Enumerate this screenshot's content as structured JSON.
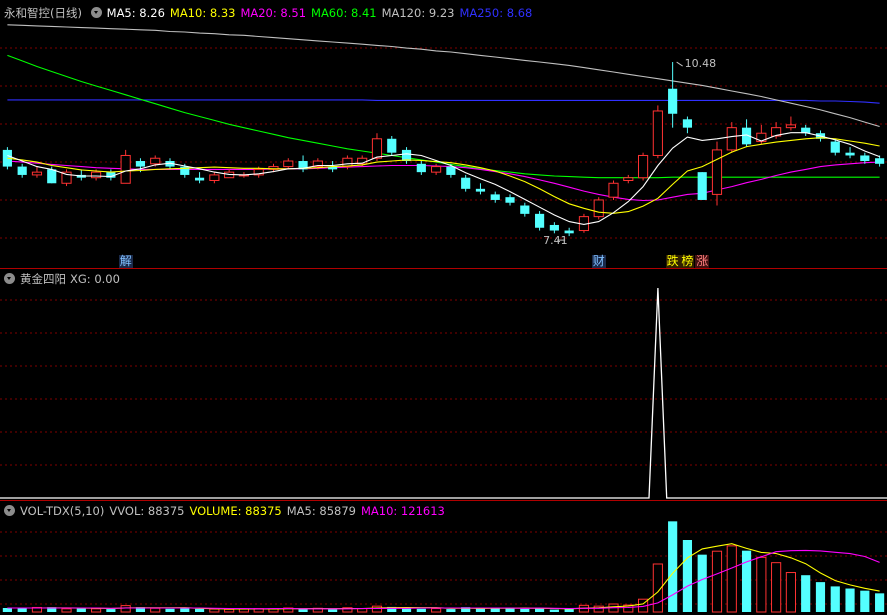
{
  "title": "永和智控(日线)",
  "ma_legend": [
    {
      "label": "MA5: 8.26",
      "color": "#ffffff"
    },
    {
      "label": "MA10: 8.33",
      "color": "#ffff00"
    },
    {
      "label": "MA20: 8.51",
      "color": "#ff00ff"
    },
    {
      "label": "MA60: 8.41",
      "color": "#00ff00"
    },
    {
      "label": "MA120: 9.23",
      "color": "#c0c0c0"
    },
    {
      "label": "MA250: 8.68",
      "color": "#3030ff"
    }
  ],
  "indicator": {
    "name": "黄金四阳",
    "xg_label": "XG: 0.00"
  },
  "volume_header": {
    "name": "VOL-TDX(5,10)",
    "items": [
      {
        "label": "VVOL: 88375",
        "color": "#c0c0c0"
      },
      {
        "label": "VOLUME: 88375",
        "color": "#ffff00"
      },
      {
        "label": "MA5: 85879",
        "color": "#c0c0c0"
      },
      {
        "label": "MA10: 121613",
        "color": "#ff00ff"
      }
    ]
  },
  "annotations": {
    "high_label": "10.48",
    "low_label": "7.41"
  },
  "events": [
    {
      "label": "解",
      "bar": 8,
      "color": "#80c0ff",
      "bg": "#1a2a4a"
    },
    {
      "label": "财",
      "bar": 40,
      "color": "#80c0ff",
      "bg": "#1a2a4a"
    },
    {
      "label": "跌",
      "bar": 45,
      "color": "#ffff00",
      "bg": "#302000"
    },
    {
      "label": "榜",
      "bar": 46,
      "color": "#ffff00",
      "bg": "#302000"
    },
    {
      "label": "涨",
      "bar": 47,
      "color": "#ff8080",
      "bg": "#401010"
    }
  ],
  "colors": {
    "up": "#ff3232",
    "down": "#54ffff",
    "grid": "#800000",
    "separator": "#b00000"
  },
  "chart_data": {
    "type": "candlestick",
    "candles": [
      [
        8.9,
        8.6,
        8.95,
        8.55
      ],
      [
        8.6,
        8.45,
        8.65,
        8.4
      ],
      [
        8.45,
        8.5,
        8.6,
        8.4
      ],
      [
        8.55,
        8.3,
        8.6,
        8.3
      ],
      [
        8.3,
        8.5,
        8.55,
        8.25
      ],
      [
        8.45,
        8.4,
        8.55,
        8.35
      ],
      [
        8.4,
        8.5,
        8.55,
        8.35
      ],
      [
        8.5,
        8.4,
        8.55,
        8.35
      ],
      [
        8.3,
        8.8,
        8.9,
        8.3
      ],
      [
        8.7,
        8.6,
        8.75,
        8.5
      ],
      [
        8.65,
        8.75,
        8.8,
        8.6
      ],
      [
        8.7,
        8.6,
        8.75,
        8.55
      ],
      [
        8.6,
        8.45,
        8.65,
        8.4
      ],
      [
        8.4,
        8.35,
        8.5,
        8.3
      ],
      [
        8.35,
        8.45,
        8.5,
        8.3
      ],
      [
        8.4,
        8.5,
        8.55,
        8.4
      ],
      [
        8.45,
        8.45,
        8.5,
        8.4
      ],
      [
        8.45,
        8.55,
        8.6,
        8.4
      ],
      [
        8.55,
        8.6,
        8.65,
        8.5
      ],
      [
        8.6,
        8.7,
        8.75,
        8.55
      ],
      [
        8.7,
        8.55,
        8.8,
        8.5
      ],
      [
        8.6,
        8.7,
        8.75,
        8.55
      ],
      [
        8.6,
        8.55,
        8.7,
        8.5
      ],
      [
        8.6,
        8.75,
        8.8,
        8.55
      ],
      [
        8.65,
        8.75,
        8.8,
        8.6
      ],
      [
        8.75,
        9.1,
        9.2,
        8.7
      ],
      [
        9.1,
        8.85,
        9.15,
        8.8
      ],
      [
        8.9,
        8.7,
        8.95,
        8.65
      ],
      [
        8.65,
        8.5,
        8.7,
        8.45
      ],
      [
        8.5,
        8.6,
        8.65,
        8.45
      ],
      [
        8.6,
        8.45,
        8.65,
        8.4
      ],
      [
        8.4,
        8.2,
        8.45,
        8.15
      ],
      [
        8.2,
        8.15,
        8.3,
        8.1
      ],
      [
        8.1,
        8.0,
        8.15,
        7.95
      ],
      [
        8.05,
        7.95,
        8.1,
        7.9
      ],
      [
        7.9,
        7.75,
        7.95,
        7.7
      ],
      [
        7.75,
        7.5,
        7.8,
        7.45
      ],
      [
        7.55,
        7.45,
        7.6,
        7.4
      ],
      [
        7.45,
        7.4,
        7.5,
        7.35
      ],
      [
        7.45,
        7.7,
        7.75,
        7.41
      ],
      [
        7.7,
        8.0,
        8.05,
        7.65
      ],
      [
        8.05,
        8.3,
        8.35,
        8.0
      ],
      [
        8.35,
        8.4,
        8.45,
        8.3
      ],
      [
        8.4,
        8.8,
        8.85,
        8.35
      ],
      [
        8.8,
        9.6,
        9.7,
        8.75
      ],
      [
        10.0,
        9.55,
        10.48,
        9.3
      ],
      [
        9.45,
        9.3,
        9.5,
        9.2
      ],
      [
        8.5,
        8.0,
        8.5,
        8.0
      ],
      [
        8.1,
        8.9,
        9.05,
        7.9
      ],
      [
        8.9,
        9.3,
        9.4,
        8.85
      ],
      [
        9.3,
        9.0,
        9.45,
        8.95
      ],
      [
        9.05,
        9.2,
        9.35,
        9.0
      ],
      [
        9.15,
        9.3,
        9.4,
        9.1
      ],
      [
        9.3,
        9.35,
        9.5,
        9.25
      ],
      [
        9.3,
        9.2,
        9.35,
        9.15
      ],
      [
        9.2,
        9.1,
        9.25,
        9.05
      ],
      [
        9.05,
        8.85,
        9.1,
        8.8
      ],
      [
        8.85,
        8.8,
        8.95,
        8.75
      ],
      [
        8.8,
        8.7,
        8.85,
        8.65
      ],
      [
        8.75,
        8.65,
        8.8,
        8.6
      ]
    ],
    "volume": [
      15,
      14,
      17,
      18,
      12,
      13,
      12,
      11,
      24,
      18,
      14,
      12,
      13,
      12,
      11,
      10,
      11,
      13,
      12,
      15,
      11,
      14,
      10,
      16,
      13,
      22,
      19,
      15,
      12,
      13,
      11,
      18,
      14,
      16,
      13,
      12,
      15,
      9,
      11,
      25,
      22,
      30,
      26,
      48,
      180,
      340,
      270,
      215,
      228,
      248,
      230,
      205,
      185,
      148,
      138,
      112,
      96,
      88,
      80,
      70
    ],
    "ma5": [
      8.8,
      8.7,
      8.6,
      8.55,
      8.46,
      8.43,
      8.43,
      8.42,
      8.52,
      8.56,
      8.63,
      8.66,
      8.61,
      8.56,
      8.5,
      8.46,
      8.45,
      8.47,
      8.51,
      8.56,
      8.57,
      8.62,
      8.62,
      8.65,
      8.66,
      8.77,
      8.8,
      8.83,
      8.8,
      8.71,
      8.62,
      8.49,
      8.38,
      8.28,
      8.15,
      8.01,
      7.87,
      7.73,
      7.61,
      7.56,
      7.61,
      7.77,
      7.97,
      8.24,
      8.62,
      8.93,
      9.13,
      9.07,
      9.1,
      9.14,
      9.17,
      9.06,
      9.16,
      9.21,
      9.21,
      9.15,
      9.08,
      9.0,
      8.88,
      8.78
    ],
    "ma10": [
      8.75,
      8.72,
      8.68,
      8.62,
      8.58,
      8.54,
      8.52,
      8.5,
      8.52,
      8.53,
      8.55,
      8.56,
      8.57,
      8.58,
      8.59,
      8.58,
      8.57,
      8.57,
      8.56,
      8.56,
      8.57,
      8.58,
      8.6,
      8.61,
      8.63,
      8.68,
      8.7,
      8.72,
      8.71,
      8.69,
      8.67,
      8.63,
      8.58,
      8.52,
      8.43,
      8.33,
      8.2,
      8.06,
      7.93,
      7.85,
      7.78,
      7.76,
      7.79,
      7.89,
      8.03,
      8.28,
      8.52,
      8.6,
      8.73,
      8.86,
      8.96,
      9.0,
      9.04,
      9.07,
      9.1,
      9.12,
      9.1,
      9.06,
      9.02,
      8.97
    ],
    "ma20": [
      8.7,
      8.68,
      8.66,
      8.64,
      8.62,
      8.6,
      8.58,
      8.57,
      8.56,
      8.55,
      8.55,
      8.55,
      8.55,
      8.55,
      8.55,
      8.55,
      8.55,
      8.55,
      8.56,
      8.56,
      8.56,
      8.57,
      8.58,
      8.59,
      8.6,
      8.61,
      8.62,
      8.62,
      8.62,
      8.61,
      8.6,
      8.58,
      8.55,
      8.51,
      8.47,
      8.42,
      8.36,
      8.3,
      8.23,
      8.16,
      8.1,
      8.05,
      8.01,
      7.99,
      8.0,
      8.05,
      8.1,
      8.12,
      8.18,
      8.24,
      8.31,
      8.37,
      8.44,
      8.5,
      8.55,
      8.6,
      8.63,
      8.65,
      8.67,
      8.68
    ],
    "ma60": [
      10.6,
      10.5,
      10.4,
      10.31,
      10.22,
      10.13,
      10.05,
      9.97,
      9.89,
      9.81,
      9.73,
      9.65,
      9.57,
      9.5,
      9.43,
      9.36,
      9.3,
      9.24,
      9.18,
      9.12,
      9.07,
      9.02,
      8.97,
      8.92,
      8.88,
      8.84,
      8.8,
      8.76,
      8.72,
      8.68,
      8.64,
      8.6,
      8.56,
      8.53,
      8.5,
      8.47,
      8.45,
      8.43,
      8.42,
      8.41,
      8.4,
      8.4,
      8.4,
      8.4,
      8.4,
      8.41,
      8.41,
      8.41,
      8.41,
      8.41,
      8.41,
      8.41,
      8.41,
      8.41,
      8.41,
      8.41,
      8.41,
      8.41,
      8.41,
      8.41
    ],
    "ma120": [
      11.15,
      11.14,
      11.13,
      11.12,
      11.11,
      11.1,
      11.09,
      11.08,
      11.07,
      11.06,
      11.05,
      11.03,
      11.02,
      11.0,
      10.99,
      10.97,
      10.96,
      10.94,
      10.92,
      10.9,
      10.88,
      10.86,
      10.84,
      10.82,
      10.8,
      10.78,
      10.76,
      10.73,
      10.71,
      10.68,
      10.66,
      10.63,
      10.6,
      10.57,
      10.54,
      10.51,
      10.48,
      10.45,
      10.42,
      10.38,
      10.34,
      10.3,
      10.26,
      10.22,
      10.18,
      10.14,
      10.1,
      10.06,
      10.01,
      9.96,
      9.91,
      9.86,
      9.8,
      9.74,
      9.68,
      9.62,
      9.55,
      9.48,
      9.4,
      9.32
    ],
    "ma250": [
      9.8,
      9.8,
      9.8,
      9.8,
      9.8,
      9.8,
      9.8,
      9.8,
      9.8,
      9.8,
      9.8,
      9.8,
      9.8,
      9.8,
      9.8,
      9.8,
      9.8,
      9.8,
      9.8,
      9.8,
      9.8,
      9.8,
      9.8,
      9.8,
      9.8,
      9.79,
      9.79,
      9.79,
      9.79,
      9.79,
      9.79,
      9.79,
      9.79,
      9.79,
      9.79,
      9.79,
      9.79,
      9.79,
      9.79,
      9.79,
      9.79,
      9.79,
      9.79,
      9.79,
      9.79,
      9.79,
      9.79,
      9.79,
      9.79,
      9.79,
      9.79,
      9.79,
      9.79,
      9.79,
      9.79,
      9.78,
      9.78,
      9.77,
      9.76,
      9.74
    ],
    "vol_ma5": [
      15,
      15,
      15,
      15.2,
      15.2,
      14.8,
      14.4,
      13.2,
      15.2,
      15.6,
      15.8,
      15.8,
      16.2,
      13.8,
      12.4,
      11.6,
      11.4,
      11.4,
      11.4,
      12.2,
      12.4,
      13,
      12.4,
      13.2,
      12.8,
      15,
      16,
      17,
      16.2,
      16.2,
      14,
      14.6,
      13.6,
      14.4,
      14.4,
      14.6,
      14,
      13,
      12,
      14.4,
      15.8,
      19.4,
      22.6,
      30.2,
      75.2,
      145.2,
      202.8,
      236.6,
      246.6,
      256.2,
      238.6,
      223.6,
      219.2,
      203.2,
      181.2,
      146.2,
      117.8,
      101.8,
      88.8,
      78.4
    ],
    "vol_ma10": [
      15,
      15,
      15,
      15,
      15,
      15,
      15,
      14,
      15,
      15,
      15,
      15,
      15,
      15,
      14,
      13,
      13,
      12,
      13,
      13,
      12,
      12,
      12,
      12,
      13,
      13,
      14,
      14,
      15,
      15,
      15,
      15,
      15,
      15,
      15,
      14,
      15,
      14,
      13,
      14,
      14,
      16,
      17,
      21,
      34,
      64,
      97,
      122,
      143,
      165,
      188,
      207,
      226,
      230,
      231,
      229,
      224,
      219,
      208,
      186
    ],
    "xg_signal": [
      0,
      0,
      0,
      0,
      0,
      0,
      0,
      0,
      0,
      0,
      0,
      0,
      0,
      0,
      0,
      0,
      0,
      0,
      0,
      0,
      0,
      0,
      0,
      0,
      0,
      0,
      0,
      0,
      0,
      0,
      0,
      0,
      0,
      0,
      0,
      0,
      0,
      0,
      0,
      0,
      0,
      0,
      0,
      0,
      1,
      0,
      0,
      0,
      0,
      0,
      0,
      0,
      0,
      0,
      0,
      0,
      0,
      0,
      0,
      0
    ],
    "price_range": [
      7.1,
      11.2
    ],
    "volume_range": [
      0,
      360
    ]
  }
}
